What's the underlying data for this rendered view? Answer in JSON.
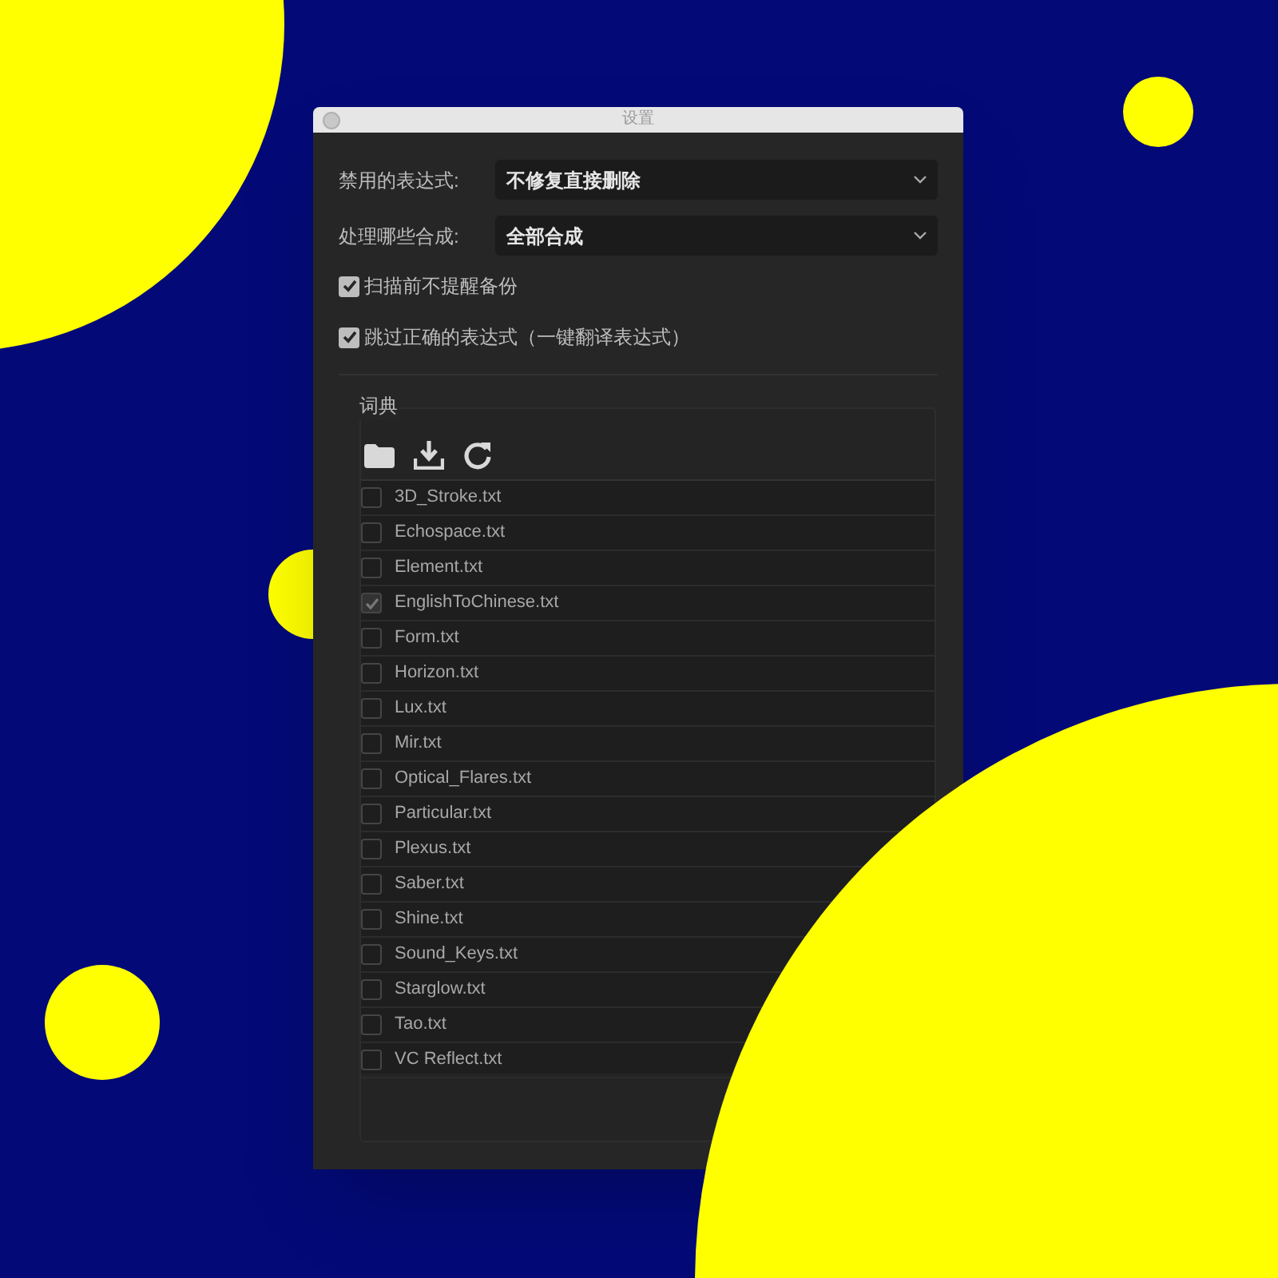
{
  "window": {
    "title": "设置"
  },
  "fields": [
    {
      "label": "禁用的表达式:",
      "value": "不修复直接删除"
    },
    {
      "label": "处理哪些合成:",
      "value": "全部合成"
    }
  ],
  "options": [
    {
      "label": "扫描前不提醒备份",
      "checked": true
    },
    {
      "label": "跳过正确的表达式（一键翻译表达式）",
      "checked": true
    }
  ],
  "dictionary": {
    "title": "词典",
    "items": [
      {
        "label": "3D_Stroke.txt",
        "checked": false
      },
      {
        "label": "Echospace.txt",
        "checked": false
      },
      {
        "label": "Element.txt",
        "checked": false
      },
      {
        "label": "EnglishToChinese.txt",
        "checked": true
      },
      {
        "label": "Form.txt",
        "checked": false
      },
      {
        "label": "Horizon.txt",
        "checked": false
      },
      {
        "label": "Lux.txt",
        "checked": false
      },
      {
        "label": "Mir.txt",
        "checked": false
      },
      {
        "label": "Optical_Flares.txt",
        "checked": false
      },
      {
        "label": "Particular.txt",
        "checked": false
      },
      {
        "label": "Plexus.txt",
        "checked": false
      },
      {
        "label": "Saber.txt",
        "checked": false
      },
      {
        "label": "Shine.txt",
        "checked": false
      },
      {
        "label": "Sound_Keys.txt",
        "checked": false
      },
      {
        "label": "Starglow.txt",
        "checked": false
      },
      {
        "label": "Tao.txt",
        "checked": false
      },
      {
        "label": "VC Reflect.txt",
        "checked": false
      }
    ]
  }
}
